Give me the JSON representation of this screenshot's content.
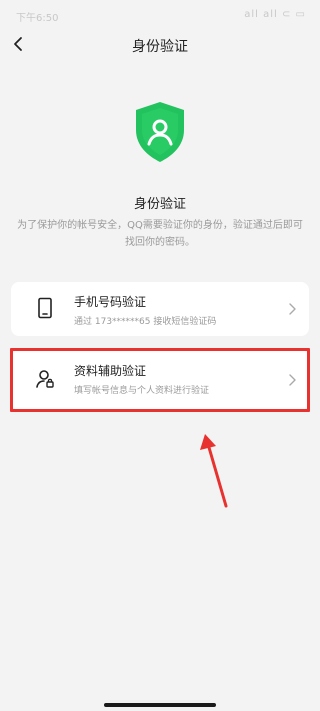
{
  "status_bar": {
    "time": "下午6:50",
    "icons_text": "all all ⊂ ▭"
  },
  "nav": {
    "title": "身份验证"
  },
  "hero": {
    "title": "身份验证",
    "description": "为了保护你的帐号安全，QQ需要验证你的身份，验证通过后即可找回你的密码。",
    "shield_color": "#22c35e"
  },
  "options": [
    {
      "title": "手机号码验证",
      "subtitle": "通过 173******65 接收短信验证码",
      "icon": "phone-icon"
    },
    {
      "title": "资料辅助验证",
      "subtitle": "填写帐号信息与个人资料进行验证",
      "icon": "user-lock-icon"
    }
  ],
  "annotation": {
    "highlight_color": "#e8322f"
  }
}
